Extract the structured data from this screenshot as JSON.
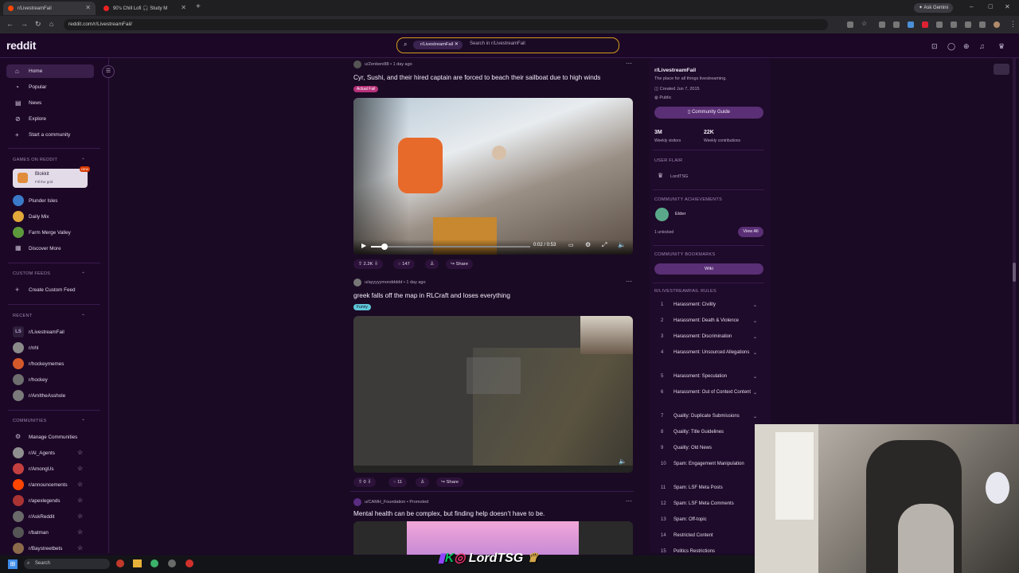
{
  "tabs": [
    {
      "label": "r/LivestreamFail",
      "active": true
    },
    {
      "label": "90's Chill Lofi 🎧 Study M",
      "active": false
    }
  ],
  "browser": {
    "url": "reddit.com/r/LivestreamFail/",
    "ask_label": "Ask Gemini"
  },
  "header": {
    "logo": "reddit",
    "search_chip": "r/LivestreamFail",
    "search_placeholder": "Search in r/LivestreamFail"
  },
  "sidebar": {
    "nav": [
      "Home",
      "Popular",
      "News",
      "Explore",
      "Start a community"
    ],
    "games_header": "GAMES ON REDDIT",
    "games": [
      {
        "name": "Blokkit",
        "sub": "Fill the grid",
        "badge": "NEW"
      },
      {
        "name": "Plunder Isles"
      },
      {
        "name": "Daily Mix"
      },
      {
        "name": "Farm Merge Valley"
      },
      {
        "name": "Discover More"
      }
    ],
    "custom_header": "CUSTOM FEEDS",
    "custom_feed": "Create Custom Feed",
    "recent_header": "RECENT",
    "recent": [
      "r/LivestreamFail",
      "r/nhl",
      "r/hockeymemes",
      "r/hockey",
      "r/AmItheAsshole"
    ],
    "communities_header": "COMMUNITIES",
    "manage": "Manage Communities",
    "communities": [
      "r/AI_Agents",
      "r/AmongUs",
      "r/announcements",
      "r/apexlegends",
      "r/AskReddit",
      "r/batman",
      "r/Baystreetbets"
    ]
  },
  "posts": [
    {
      "user": "u/Zenbeni88",
      "time": "1 day ago",
      "title": "Cyr, Sushi, and their hired captain are forced to beach their sailboat due to high winds",
      "flair": "Actual Fail",
      "video_time": "0:02 / 0:53",
      "upvotes": "2.2K",
      "comments": "147",
      "share": "Share"
    },
    {
      "user": "u/ayyyyymonddddd",
      "time": "1 day ago",
      "title": "greek falls off the map in RLCraft and loses everything",
      "flair": "Funny",
      "upvotes": "0",
      "comments": "11",
      "share": "Share"
    },
    {
      "user": "u/CAMH_Foundation",
      "time": "Promoted",
      "title": "Mental health can be complex, but finding help doesn’t have to be."
    }
  ],
  "community": {
    "name": "r/LivestreamFail",
    "description": "The place for all things livestreaming.",
    "created": "Created Jun 7, 2015",
    "visibility": "Public",
    "guide_button": "Community Guide",
    "stats": [
      {
        "value": "3M",
        "label": "Weekly visitors"
      },
      {
        "value": "22K",
        "label": "Weekly contributions"
      }
    ],
    "user_flair_header": "USER FLAIR",
    "user_flair": "LordTSG",
    "achievements_header": "COMMUNITY ACHIEVEMENTS",
    "achievement": "Elder",
    "unlocked": "1 unlocked",
    "view_all": "View All",
    "bookmarks_header": "COMMUNITY BOOKMARKS",
    "wiki": "Wiki",
    "rules_header": "R/LIVESTREAMFAIL RULES",
    "rules": [
      "Harassment: Civility",
      "Harassment: Death & Violence",
      "Harassment: Discrimination",
      "Harassment: Unsourced Allegations",
      "Harassment: Speculation",
      "Harassment: Out of Context Content",
      "Quality: Duplicate Submissions",
      "Quality: Title Guidelines",
      "Quality: Old News",
      "Spam: Engagement Manipulation",
      "Spam: LSF Meta Posts",
      "Spam: LSF Meta Comments",
      "Spam: Off-topic",
      "Restricted Content",
      "Politics Restrictions"
    ]
  },
  "taskbar": {
    "search": "Search"
  },
  "overlay": {
    "streamer": "LordTSG"
  },
  "colors": {
    "background": "#1a0a24",
    "accent": "#6a1b9a",
    "search_border": "#d59a1b"
  }
}
